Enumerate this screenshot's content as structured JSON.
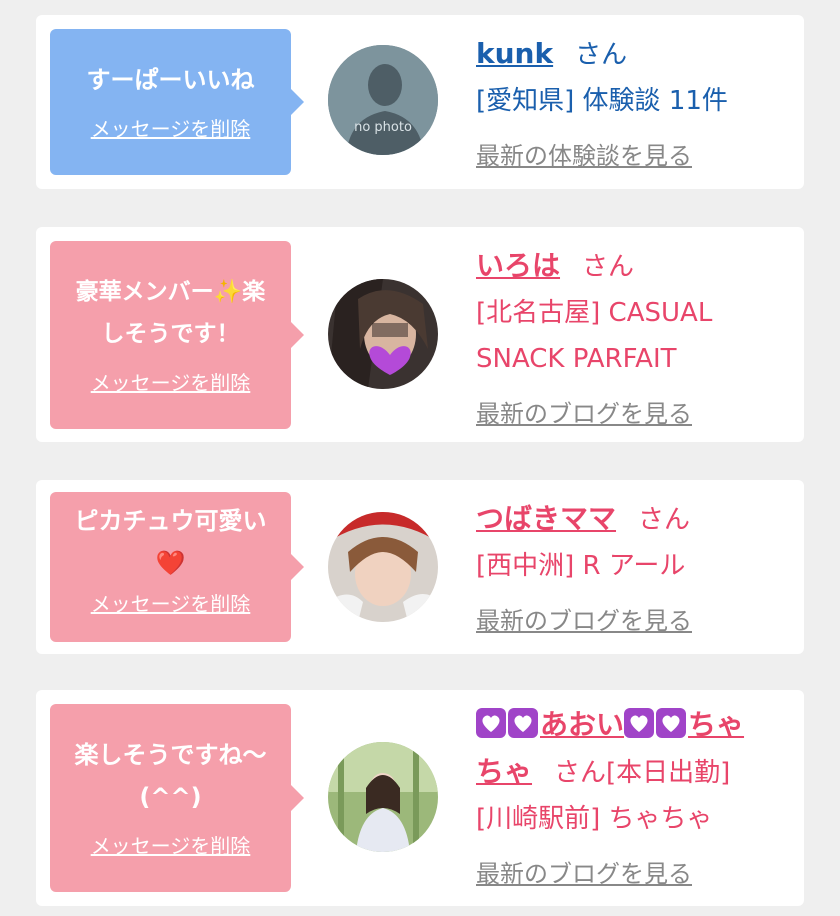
{
  "items": [
    {
      "bubble_message": "すーぱーいいね",
      "delete_label": "メッセージを削除",
      "name": "kunk",
      "honorific": "さん",
      "detail_lines": [
        "[愛知県] 体験談 11件"
      ],
      "more_link": "最新の体験談を見る",
      "avatar_text": "no photo",
      "bubble_color": "#84b4f2",
      "accent_color": "#1a5fad"
    },
    {
      "bubble_message_lines": [
        "豪華メンバー✨楽",
        "しそうです！"
      ],
      "delete_label": "メッセージを削除",
      "name": "いろは",
      "honorific": "さん",
      "detail_lines": [
        "[北名古屋] CASUAL",
        "SNACK PARFAIT"
      ],
      "more_link": "最新のブログを見る",
      "bubble_color": "#f59fab",
      "accent_color": "#e8456a"
    },
    {
      "bubble_message_lines": [
        "ピカチュウ可愛い",
        "❤️"
      ],
      "delete_label": "メッセージを削除",
      "name": "つばきママ",
      "honorific": "さん",
      "detail_lines": [
        "[西中洲] R アール"
      ],
      "more_link": "最新のブログを見る",
      "bubble_color": "#f59fab",
      "accent_color": "#e8456a"
    },
    {
      "bubble_message_lines": [
        "楽しそうですね〜",
        "(^^)"
      ],
      "delete_label": "メッセージを削除",
      "name_parts": [
        "あおい",
        "ちゃ",
        "ちゃ"
      ],
      "honorific": "さん",
      "status": "[本日出勤]",
      "detail_lines": [
        "[川崎駅前] ちゃちゃ"
      ],
      "more_link": "最新のブログを見る",
      "bubble_color": "#f59fab",
      "accent_color": "#e8456a"
    }
  ]
}
